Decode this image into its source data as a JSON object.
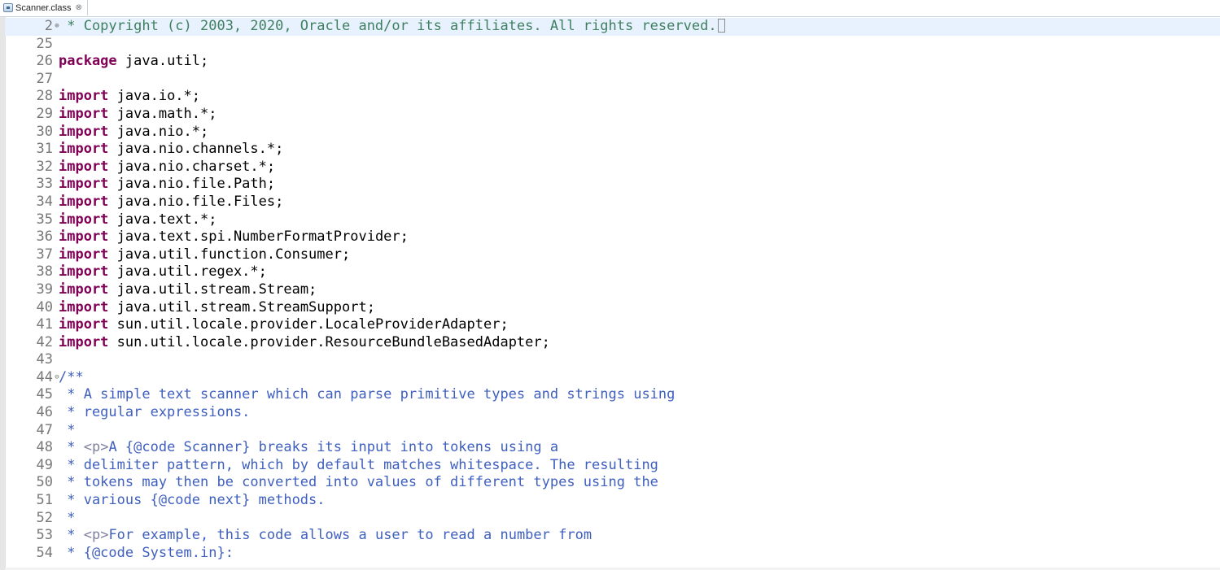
{
  "tab": {
    "title": "Scanner.class",
    "close_glyph": "⊗"
  },
  "lines": [
    {
      "num": "2",
      "fold": "⊕",
      "current": true,
      "parts": [
        {
          "t": "cmt",
          "v": " * Copyright (c) 2003, 2020, Oracle and/or its affiliates. All rights reserved."
        }
      ],
      "box": true
    },
    {
      "num": "25",
      "parts": []
    },
    {
      "num": "26",
      "parts": [
        {
          "t": "kw",
          "v": "package"
        },
        {
          "t": "n",
          "v": " java.util;"
        }
      ]
    },
    {
      "num": "27",
      "parts": []
    },
    {
      "num": "28",
      "parts": [
        {
          "t": "kw",
          "v": "import"
        },
        {
          "t": "n",
          "v": " java.io.*;"
        }
      ]
    },
    {
      "num": "29",
      "parts": [
        {
          "t": "kw",
          "v": "import"
        },
        {
          "t": "n",
          "v": " java.math.*;"
        }
      ]
    },
    {
      "num": "30",
      "parts": [
        {
          "t": "kw",
          "v": "import"
        },
        {
          "t": "n",
          "v": " java.nio.*;"
        }
      ]
    },
    {
      "num": "31",
      "parts": [
        {
          "t": "kw",
          "v": "import"
        },
        {
          "t": "n",
          "v": " java.nio.channels.*;"
        }
      ]
    },
    {
      "num": "32",
      "parts": [
        {
          "t": "kw",
          "v": "import"
        },
        {
          "t": "n",
          "v": " java.nio.charset.*;"
        }
      ]
    },
    {
      "num": "33",
      "parts": [
        {
          "t": "kw",
          "v": "import"
        },
        {
          "t": "n",
          "v": " java.nio.file.Path;"
        }
      ]
    },
    {
      "num": "34",
      "parts": [
        {
          "t": "kw",
          "v": "import"
        },
        {
          "t": "n",
          "v": " java.nio.file.Files;"
        }
      ]
    },
    {
      "num": "35",
      "parts": [
        {
          "t": "kw",
          "v": "import"
        },
        {
          "t": "n",
          "v": " java.text.*;"
        }
      ]
    },
    {
      "num": "36",
      "parts": [
        {
          "t": "kw",
          "v": "import"
        },
        {
          "t": "n",
          "v": " java.text.spi.NumberFormatProvider;"
        }
      ]
    },
    {
      "num": "37",
      "parts": [
        {
          "t": "kw",
          "v": "import"
        },
        {
          "t": "n",
          "v": " java.util.function.Consumer;"
        }
      ]
    },
    {
      "num": "38",
      "parts": [
        {
          "t": "kw",
          "v": "import"
        },
        {
          "t": "n",
          "v": " java.util.regex.*;"
        }
      ]
    },
    {
      "num": "39",
      "parts": [
        {
          "t": "kw",
          "v": "import"
        },
        {
          "t": "n",
          "v": " java.util.stream.Stream;"
        }
      ]
    },
    {
      "num": "40",
      "parts": [
        {
          "t": "kw",
          "v": "import"
        },
        {
          "t": "n",
          "v": " java.util.stream.StreamSupport;"
        }
      ]
    },
    {
      "num": "41",
      "parts": [
        {
          "t": "kw",
          "v": "import"
        },
        {
          "t": "n",
          "v": " sun.util.locale.provider.LocaleProviderAdapter;"
        }
      ]
    },
    {
      "num": "42",
      "parts": [
        {
          "t": "kw",
          "v": "import"
        },
        {
          "t": "n",
          "v": " sun.util.locale.provider.ResourceBundleBasedAdapter;"
        }
      ]
    },
    {
      "num": "43",
      "parts": []
    },
    {
      "num": "44",
      "fold": "⊖",
      "parts": [
        {
          "t": "doc",
          "v": "/**"
        }
      ]
    },
    {
      "num": "45",
      "parts": [
        {
          "t": "doc",
          "v": " * A simple text scanner which can parse primitive types and strings using"
        }
      ]
    },
    {
      "num": "46",
      "parts": [
        {
          "t": "doc",
          "v": " * regular expressions."
        }
      ]
    },
    {
      "num": "47",
      "parts": [
        {
          "t": "doc",
          "v": " *"
        }
      ]
    },
    {
      "num": "48",
      "parts": [
        {
          "t": "doc",
          "v": " * "
        },
        {
          "t": "tag",
          "v": "<p>"
        },
        {
          "t": "doc",
          "v": "A {@code Scanner} breaks its input into tokens using a"
        }
      ]
    },
    {
      "num": "49",
      "parts": [
        {
          "t": "doc",
          "v": " * delimiter pattern, which by default matches whitespace. The resulting"
        }
      ]
    },
    {
      "num": "50",
      "parts": [
        {
          "t": "doc",
          "v": " * tokens may then be converted into values of different types using the"
        }
      ]
    },
    {
      "num": "51",
      "parts": [
        {
          "t": "doc",
          "v": " * various {@code next} methods."
        }
      ]
    },
    {
      "num": "52",
      "parts": [
        {
          "t": "doc",
          "v": " *"
        }
      ]
    },
    {
      "num": "53",
      "parts": [
        {
          "t": "doc",
          "v": " * "
        },
        {
          "t": "tag",
          "v": "<p>"
        },
        {
          "t": "doc",
          "v": "For example, this code allows a user to read a number from"
        }
      ]
    },
    {
      "num": "54",
      "parts": [
        {
          "t": "doc",
          "v": " * {@code System.in}:"
        }
      ]
    }
  ]
}
